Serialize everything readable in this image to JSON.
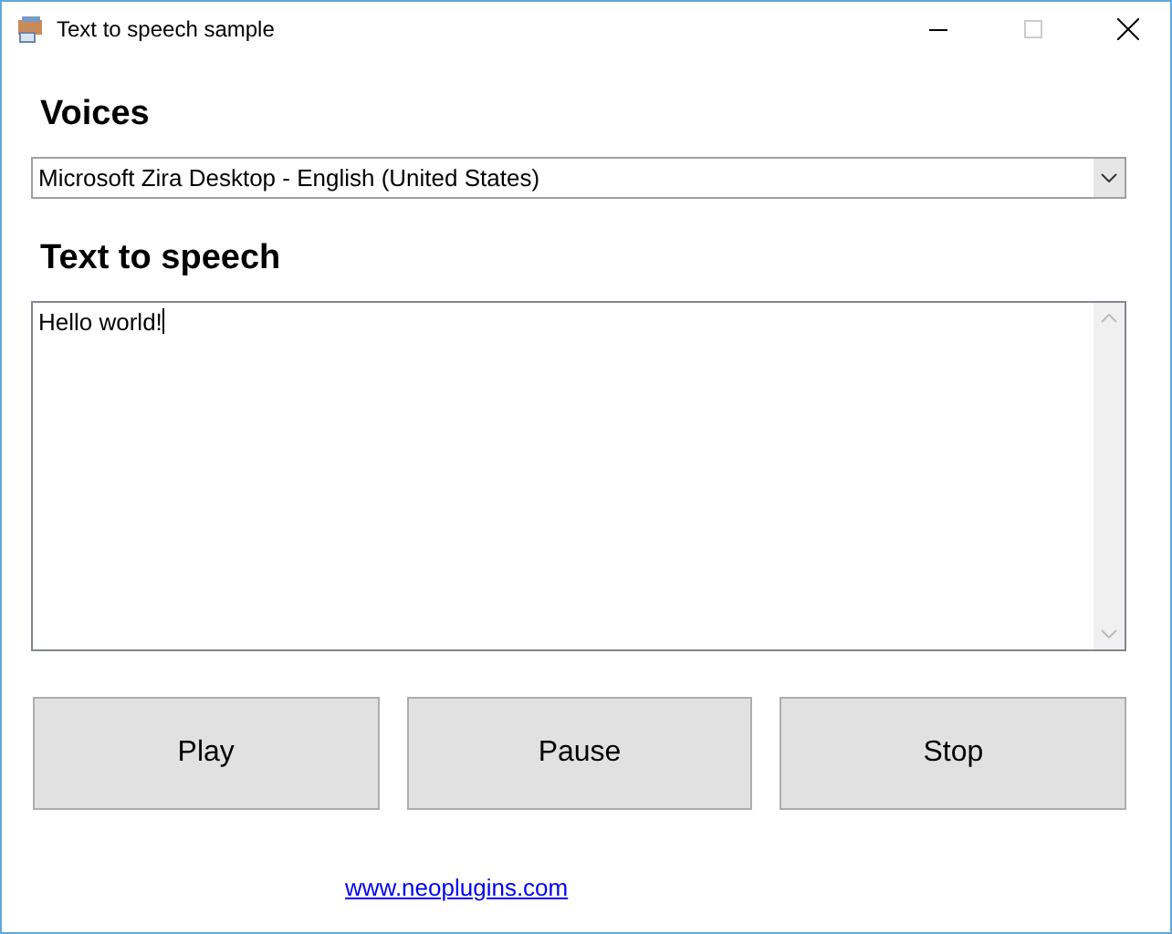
{
  "window": {
    "title": "Text to speech sample"
  },
  "voices": {
    "heading": "Voices",
    "value": "Microsoft Zira Desktop - English (United States)"
  },
  "text": {
    "heading": "Text to speech",
    "value": "Hello world!"
  },
  "buttons": [
    "Play",
    "Pause",
    "Stop"
  ],
  "link": "www.neoplugins.com"
}
